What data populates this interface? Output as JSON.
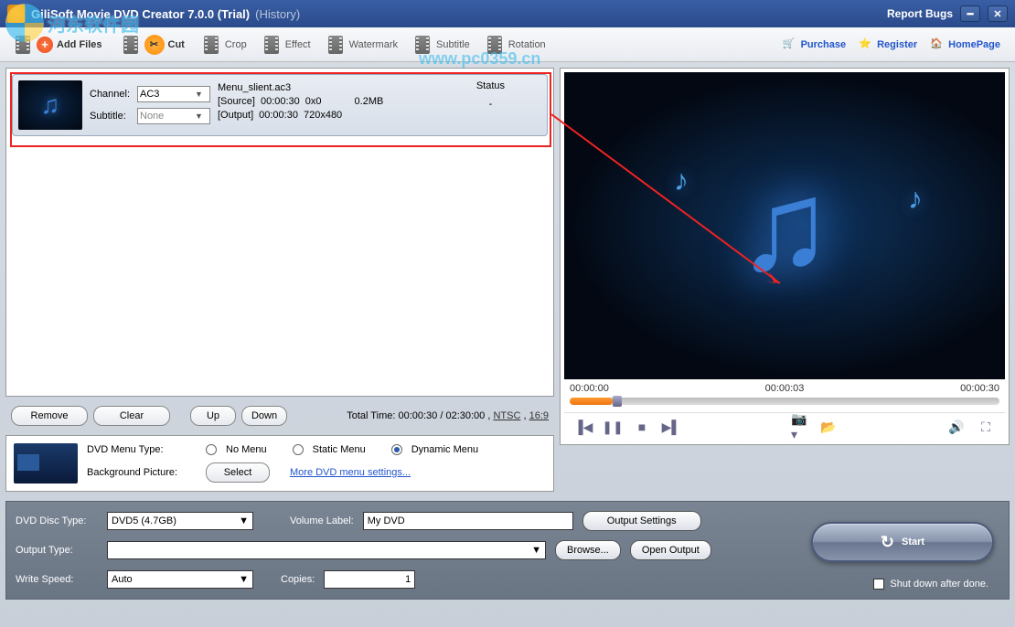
{
  "title": {
    "main": "GiliSoft Movie DVD Creator 7.0.0 (Trial)",
    "history": "(History)"
  },
  "titlebar": {
    "report_bugs": "Report Bugs"
  },
  "toolbar": {
    "add_files": "Add Files",
    "cut": "Cut",
    "crop": "Crop",
    "effect": "Effect",
    "watermark": "Watermark",
    "subtitle": "Subtitle",
    "rotation": "Rotation"
  },
  "top_links": {
    "purchase": "Purchase",
    "register": "Register",
    "homepage": "HomePage"
  },
  "file_row": {
    "channel_label": "Channel:",
    "channel_value": "AC3",
    "subtitle_label": "Subtitle:",
    "subtitle_value": "None",
    "filename": "Menu_slient.ac3",
    "source_label": "[Source]",
    "source_time": "00:00:30",
    "source_res": "0x0",
    "source_size": "0.2MB",
    "output_label": "[Output]",
    "output_time": "00:00:30",
    "output_res": "720x480",
    "status_header": "Status",
    "status_value": "-"
  },
  "list_actions": {
    "remove": "Remove",
    "clear": "Clear",
    "up": "Up",
    "down": "Down",
    "total_prefix": "Total Time:",
    "total_value": "00:00:30 / 02:30:00",
    "format": "NTSC",
    "aspect": "16:9"
  },
  "menu_panel": {
    "type_label": "DVD Menu Type:",
    "no_menu": "No Menu",
    "static_menu": "Static Menu",
    "dynamic_menu": "Dynamic Menu",
    "bg_label": "Background  Picture:",
    "select": "Select",
    "more": "More DVD menu settings..."
  },
  "preview": {
    "t_start": "00:00:00",
    "t_mid": "00:00:03",
    "t_end": "00:00:30"
  },
  "bottom": {
    "disc_type_label": "DVD Disc Type:",
    "disc_type_value": "DVD5 (4.7GB)",
    "volume_label": "Volume Label:",
    "volume_value": "My DVD",
    "output_settings": "Output Settings",
    "output_type_label": "Output Type:",
    "output_type_value": "",
    "browse": "Browse...",
    "open_output": "Open Output",
    "write_speed_label": "Write Speed:",
    "write_speed_value": "Auto",
    "copies_label": "Copies:",
    "copies_value": "1",
    "start": "Start",
    "shutdown": "Shut down after done."
  },
  "watermark": {
    "text": "河东软件园",
    "url": "www.pc0359.cn"
  }
}
